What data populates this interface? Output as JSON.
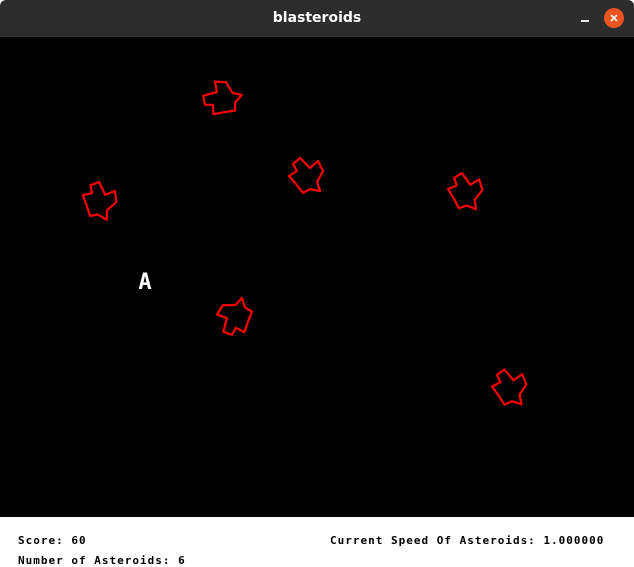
{
  "window": {
    "title": "blasteroids",
    "minimize_icon": "minimize-icon",
    "close_icon": "close-icon",
    "close_color": "#e95420"
  },
  "game": {
    "background": "#000000",
    "ship_glyph": "A",
    "ship_color": "#ffffff",
    "asteroid_color": "#ff0000",
    "asteroid_count_visible": 6
  },
  "hud": {
    "score_label": "Score:",
    "score_value": "60",
    "speed_label": "Current Speed Of Asteroids:",
    "speed_value": "1.000000",
    "count_label": "Number of Asteroids:",
    "count_value": "6"
  }
}
